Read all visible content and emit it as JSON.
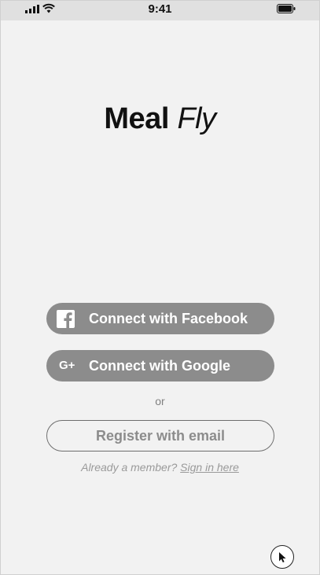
{
  "status_bar": {
    "time": "9:41",
    "icons": [
      "cellular-signal-icon",
      "wifi-icon",
      "battery-icon"
    ]
  },
  "logo": {
    "word_1": "Meal",
    "word_2": "Fly"
  },
  "auth": {
    "facebook_label": "Connect with Facebook",
    "facebook_icon": "facebook-icon",
    "google_icon_text": "G+",
    "google_label": "Connect with Google",
    "separator": "or",
    "email_label": "Register with email",
    "already_member": "Already a member?",
    "sign_in_link": "Sign in here"
  },
  "colors": {
    "background": "#f2f2f2",
    "status_bar": "#e0e0e0",
    "button_fill": "#8c8c8c",
    "button_text": "#ffffff",
    "muted_text": "#9a9a9a",
    "logo_text": "#111111"
  },
  "pointer": {
    "icon": "mouse-pointer-icon"
  }
}
